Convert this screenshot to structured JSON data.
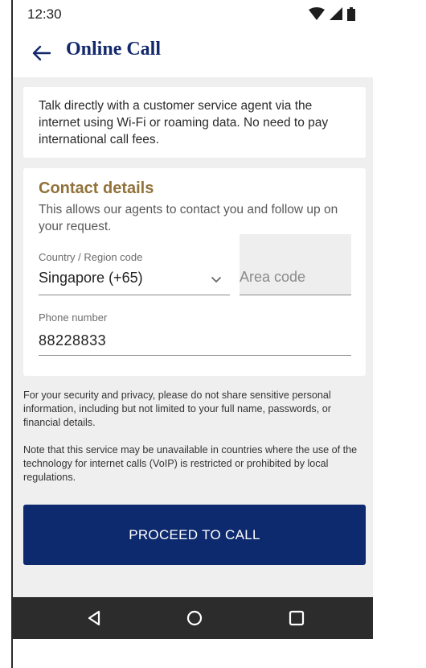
{
  "status_bar": {
    "time": "12:30",
    "icons": [
      "wifi-icon",
      "cellular-signal-icon",
      "battery-icon"
    ]
  },
  "app_bar": {
    "title": "Online Call",
    "back_icon": "arrow-left-icon"
  },
  "intro": {
    "text": "Talk directly with a customer service agent via the internet using Wi-Fi or roaming data. No need to pay international call fees."
  },
  "contact": {
    "title": "Contact details",
    "subtitle": "This allows our agents to contact you and follow up on your request.",
    "country": {
      "label": "Country / Region code",
      "value": "Singapore (+65)"
    },
    "area": {
      "placeholder": "Area code"
    },
    "phone": {
      "label": "Phone number",
      "value": "88228833"
    }
  },
  "notes": {
    "security": "For your security and privacy, please do not share sensitive personal information, including but not limited to your full name, passwords, or financial details.",
    "availability": "Note that this service may be unavailable in countries where the use of the technology for internet calls (VoIP) is restricted or prohibited by local regulations."
  },
  "proceed_button": {
    "label": "PROCEED TO CALL"
  },
  "colors": {
    "title_navy": "#13296b",
    "button_navy": "#0e2a6e",
    "accent_gold": "#92723a",
    "content_bg": "#efefef",
    "navbar_bg": "#2c2c2c"
  }
}
